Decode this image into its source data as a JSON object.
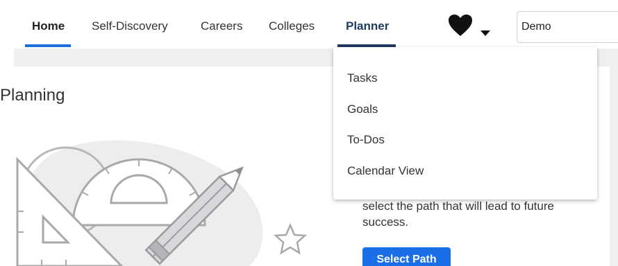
{
  "nav": {
    "items": [
      {
        "label": "Home"
      },
      {
        "label": "Self-Discovery"
      },
      {
        "label": "Careers"
      },
      {
        "label": "Colleges"
      },
      {
        "label": "Planner"
      }
    ],
    "icons": [
      "heart-icon",
      "caret-down-icon"
    ],
    "search_value": "Demo"
  },
  "colors": {
    "home_underline": "#1b6fdc",
    "planner_underline": "#1f3a5f",
    "primary_button": "#1a6ee8"
  },
  "dropdown": {
    "items": [
      {
        "label": "Tasks"
      },
      {
        "label": "Goals"
      },
      {
        "label": "To-Dos"
      },
      {
        "label": "Calendar View"
      }
    ]
  },
  "main": {
    "title": "Planning",
    "description": "select the path that will lead to future success.",
    "select_button": "Select Path"
  }
}
